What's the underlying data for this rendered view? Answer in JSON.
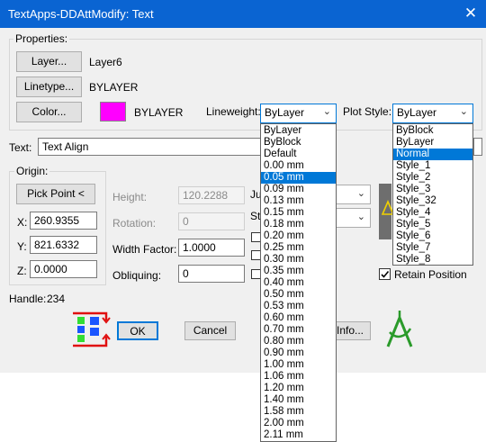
{
  "window": {
    "title": "TextApps-DDAttModify: Text",
    "close_glyph": "✕"
  },
  "properties": {
    "group_label": "Properties:",
    "layer_button": "Layer...",
    "layer_value": "Layer6",
    "linetype_button": "Linetype...",
    "linetype_value": "BYLAYER",
    "color_button": "Color...",
    "color_value": "BYLAYER",
    "color_swatch": "#ff00ff",
    "lineweight_label": "Lineweight:",
    "lineweight_selected": "ByLayer",
    "plotstyle_label": "Plot Style:",
    "plotstyle_selected": "ByLayer"
  },
  "text": {
    "label": "Text:",
    "value": "Text Align"
  },
  "origin": {
    "group_label": "Origin:",
    "pick_point_button": "Pick Point <",
    "x_label": "X:",
    "x_value": "260.9355",
    "y_label": "Y:",
    "y_value": "821.6332",
    "z_label": "Z:",
    "z_value": "0.0000"
  },
  "params": {
    "height_label": "Height:",
    "height_value": "120.2288",
    "rotation_label": "Rotation:",
    "rotation_value": "0",
    "width_factor_label": "Width Factor:",
    "width_factor_value": "1.0000",
    "obliquing_label": "Obliquing:",
    "obliquing_value": "0",
    "justify_label_partial": "Ju",
    "style_label_partial": "St"
  },
  "retain_position": {
    "label": "Retain Position",
    "checked": true
  },
  "handle": {
    "label": "Handle:",
    "value": "234"
  },
  "buttons": {
    "ok": "OK",
    "cancel": "Cancel",
    "info": "Info..."
  },
  "lineweight_options": [
    "ByLayer",
    "ByBlock",
    "Default",
    "0.00 mm",
    "0.05 mm",
    "0.09 mm",
    "0.13 mm",
    "0.15 mm",
    "0.18 mm",
    "0.20 mm",
    "0.25 mm",
    "0.30 mm",
    "0.35 mm",
    "0.40 mm",
    "0.50 mm",
    "0.53 mm",
    "0.60 mm",
    "0.70 mm",
    "0.80 mm",
    "0.90 mm",
    "1.00 mm",
    "1.06 mm",
    "1.20 mm",
    "1.40 mm",
    "1.58 mm",
    "2.00 mm",
    "2.11 mm"
  ],
  "lineweight_highlighted": "0.05 mm",
  "plotstyle_options": [
    "ByBlock",
    "ByLayer",
    "Normal",
    "Style_1",
    "Style_2",
    "Style_3",
    "Style_32",
    "Style_4",
    "Style_5",
    "Style_6",
    "Style_7",
    "Style_8"
  ],
  "plotstyle_highlighted": "Normal",
  "colors": {
    "accent": "#0078d7",
    "titlebar": "#0a64d2"
  }
}
